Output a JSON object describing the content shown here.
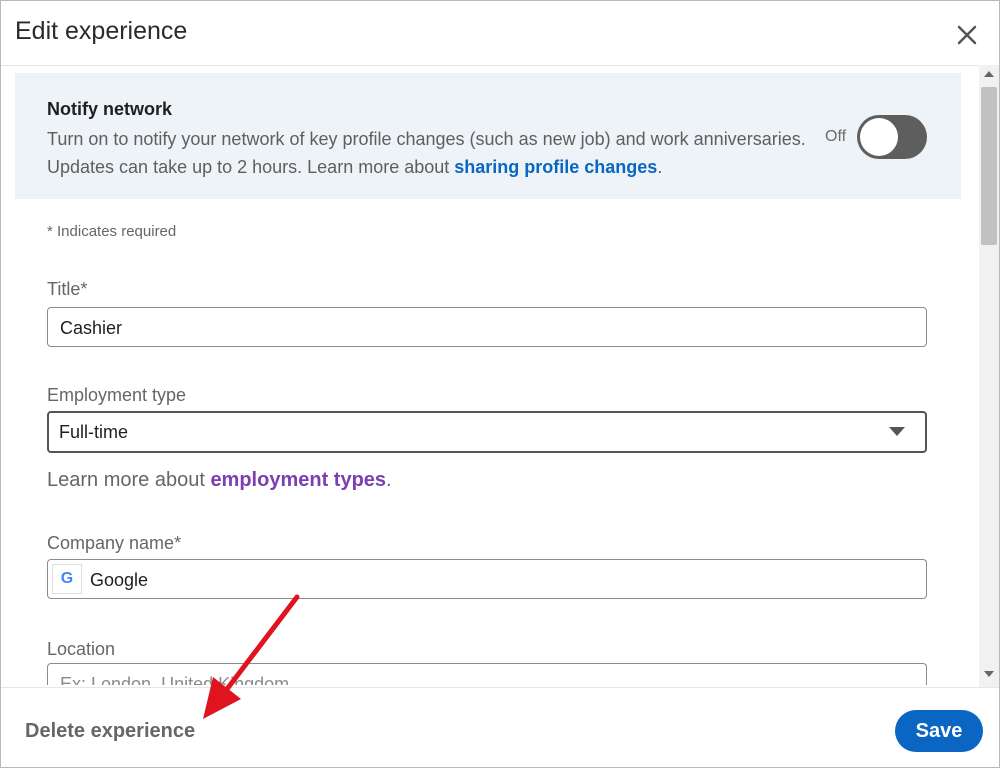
{
  "dialog": {
    "title": "Edit experience",
    "close_icon": "close-icon"
  },
  "notify": {
    "title": "Notify network",
    "description": "Turn on to notify your network of key profile changes (such as new job) and work anniversaries. Updates can take up to 2 hours. Learn more about ",
    "link_text": "sharing profile changes",
    "description_end": ".",
    "toggle_label": "Off",
    "toggle_on": false
  },
  "form": {
    "required_note": "* Indicates required",
    "title": {
      "label": "Title*",
      "value": "Cashier"
    },
    "employment_type": {
      "label": "Employment type",
      "value": "Full-time"
    },
    "learn_more": {
      "text": "Learn more about ",
      "link_text": "employment types",
      "end": "."
    },
    "company": {
      "label": "Company name*",
      "value": "Google",
      "logo_letter": "G"
    },
    "location": {
      "label": "Location",
      "placeholder": "Ex: London, United Kingdom"
    }
  },
  "footer": {
    "delete_label": "Delete experience",
    "save_label": "Save"
  },
  "colors": {
    "accent": "#0a66c2",
    "annotation_arrow": "#e0141e",
    "link_visited": "#7b3fb3"
  }
}
